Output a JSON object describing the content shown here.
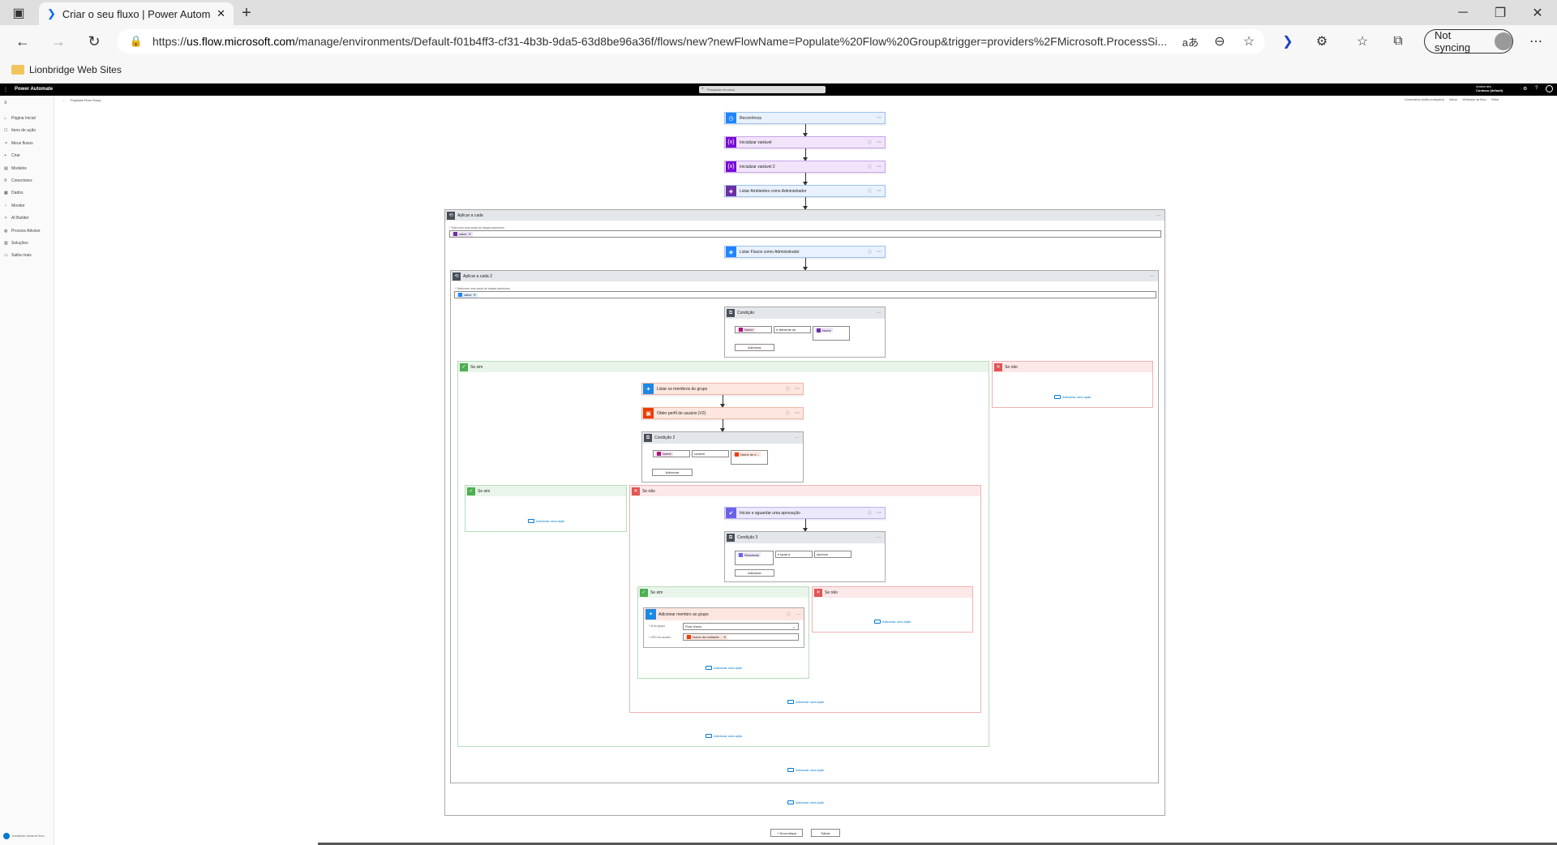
{
  "browser": {
    "tab_title": "Criar o seu fluxo | Power Automa",
    "url_host": "us.flow.microsoft.com",
    "url_rest": "/manage/environments/Default-f01b4ff3-cf31-4b3b-9da5-63d8be96a36f/flows/new?newFlowName=Populate%20Flow%20Group&trigger=providers%2FMicrosoft.ProcessSi...",
    "url_scheme": "https://",
    "not_syncing": "Not syncing",
    "favorites_folder": "Lionbridge Web Sites"
  },
  "app": {
    "name": "Power Automate",
    "search_placeholder": "Pesquisar recursos",
    "env_label": "Ambientes",
    "env_name": "Contoso (default)",
    "breadcrumb": "Populate Flow Group",
    "cmd_checker": "Verificador de fluxo",
    "cmd_save": "Salvar",
    "cmd_test": "Testar",
    "cmd_comments": "Comentários (estão protegidos)"
  },
  "nav": [
    {
      "icon": "home-icon",
      "label": "Página Inicial"
    },
    {
      "icon": "actions-icon",
      "label": "Itens de ação"
    },
    {
      "icon": "flow-icon",
      "label": "Meus fluxos"
    },
    {
      "icon": "plus-icon",
      "label": "Criar"
    },
    {
      "icon": "template-icon",
      "label": "Modelos"
    },
    {
      "icon": "connector-icon",
      "label": "Conectores"
    },
    {
      "icon": "data-icon",
      "label": "Dados"
    },
    {
      "icon": "monitor-icon",
      "label": "Monitor"
    },
    {
      "icon": "ai-icon",
      "label": "AI Builder"
    },
    {
      "icon": "process-icon",
      "label": "Process Advisor"
    },
    {
      "icon": "solution-icon",
      "label": "Soluções"
    },
    {
      "icon": "learn-icon",
      "label": "Saiba mais"
    }
  ],
  "nav_footer": "Assistente virtual de fluxo",
  "flow": {
    "recurrence": "Recorrência",
    "init1": "Inicializar variável",
    "init2": "Inicializar variável 2",
    "list_envs": "Listar Ambientes como Administrador",
    "apply_each": "Aplicar a cada",
    "apply_each_hint": "* Selecione uma saída de etapas anteriores",
    "token_value": "value",
    "list_flows": "Listar Fluxos como Administrador",
    "apply_each2": "Aplicar a cada 2",
    "condition": "Condição",
    "cond_op": "é diferente de",
    "cond_left": "Nome",
    "cond_right": "Nome",
    "add": "Adicionar",
    "if_yes": "Se sim",
    "if_no": "Se não",
    "add_action": "Adicionar uma ação",
    "list_members": "Listar os membros do grupo",
    "get_profile": "Obter perfil do usuário (V2)",
    "condition2": "Condição 2",
    "cond2_op": "contém",
    "cond2_right": "Nome de e...",
    "approval": "Iniciar e aguardar uma aprovação",
    "condition3": "Condição 3",
    "cond3_left": "Resultado",
    "cond3_op": "é igual a",
    "cond3_right": "Aprovar",
    "add_member": "Adicionar membro ao grupo",
    "group_id_label": "* Id do grupo",
    "group_id_value": "Flow Users",
    "upn_label": "* UPN do usuário",
    "upn_value": "Nome da entidade...",
    "new_step": "+ Nova etapa",
    "save": "Salvar"
  },
  "colors": {
    "recurrence": "#1f85ff",
    "variable": "#770bd6",
    "admin": "#6b2fa4",
    "control": "#484f58",
    "teams": "#1e88e5",
    "office": "#eb3c00",
    "approval": "#6a63e8"
  }
}
